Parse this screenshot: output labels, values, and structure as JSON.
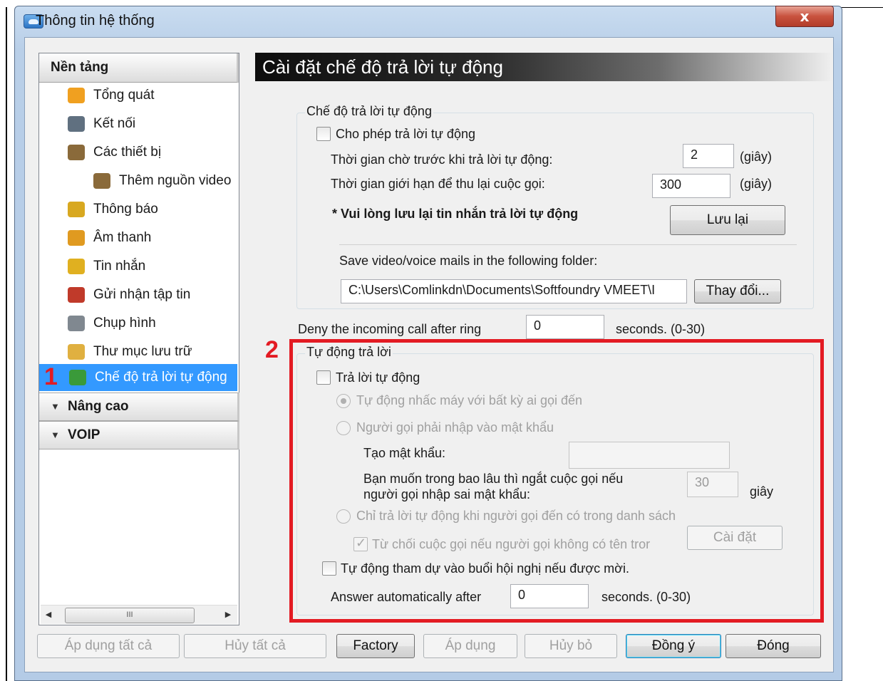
{
  "window": {
    "title": "Thông tin hệ thống",
    "close_label": "x"
  },
  "sidebar": {
    "header": "Nền tảng",
    "items": [
      {
        "label": "Tổng quát",
        "icon": "gear-icon",
        "color": "#f0a020"
      },
      {
        "label": "Kết nối",
        "icon": "network-icon",
        "color": "#607080"
      },
      {
        "label": "Các thiết bị",
        "icon": "devices-icon",
        "color": "#8a6a3a"
      },
      {
        "label": "Thêm nguồn video",
        "icon": "video-source-icon",
        "color": "#8a6a3a"
      },
      {
        "label": "Thông báo",
        "icon": "notification-icon",
        "color": "#d8a820"
      },
      {
        "label": "Âm thanh",
        "icon": "music-note-icon",
        "color": "#e09a20"
      },
      {
        "label": "Tin nhắn",
        "icon": "message-icon",
        "color": "#e0b020"
      },
      {
        "label": "Gửi nhận tập tin",
        "icon": "file-transfer-icon",
        "color": "#c03a2a"
      },
      {
        "label": "Chụp hình",
        "icon": "camera-icon",
        "color": "#808890"
      },
      {
        "label": "Thư mục lưu trữ",
        "icon": "folder-icon",
        "color": "#e0b040"
      },
      {
        "label": "Chế độ trả lời tự động",
        "icon": "auto-answer-icon",
        "color": "#3a9a3a"
      }
    ],
    "sections": [
      {
        "label": "Nâng cao"
      },
      {
        "label": "VOIP"
      }
    ],
    "scroll_thumb": "III"
  },
  "main": {
    "header": "Cài đặt chế độ trả lời tự động",
    "group1": {
      "title": "Chế độ trả lời tự động",
      "allow_label": "Cho phép trả lời tự động",
      "wait_label": "Thời gian chờ trước khi trả lời tự động:",
      "wait_value": "2",
      "wait_unit": "(giây)",
      "limit_label": "Thời gian giới hạn để thu lại cuộc gọi:",
      "limit_value": "300",
      "limit_unit": "(giây)",
      "save_note": "* Vui lòng lưu lại tin nhắn trả lời tự động",
      "save_button": "Lưu lại",
      "folder_label": "Save video/voice mails in the following folder:",
      "folder_value": "C:\\Users\\Comlinkdn\\Documents\\Softfoundry VMEET\\I",
      "change_button": "Thay đổi..."
    },
    "deny": {
      "label": "Deny the incoming call after ring",
      "value": "0",
      "unit": "seconds. (0-30)"
    },
    "group2": {
      "title": "Tự động trả lời",
      "auto_answer_label": "Trả lời tự động",
      "radio_any": "Tự động nhấc máy với bất kỳ ai gọi đến",
      "radio_password": "Người gọi phải nhập vào mật khẩu",
      "create_password_label": "Tạo mật khẩu:",
      "create_password_value": "",
      "timeout_label_1": "Bạn muốn trong bao lâu thì ngắt cuộc gọi nếu",
      "timeout_label_2": "người gọi nhập sai mật khẩu:",
      "timeout_value": "30",
      "timeout_unit": "giây",
      "radio_list": "Chỉ trả lời tự động khi người gọi đến có trong danh sách",
      "reject_label": "Từ chối cuộc gọi nếu người gọi không có tên tror",
      "setup_button": "Cài đặt",
      "conference_label": "Tự động tham dự vào buổi hội nghị nếu được mời.",
      "answer_after_label": "Answer automatically after",
      "answer_after_value": "0",
      "answer_after_unit": "seconds. (0-30)"
    }
  },
  "footer": {
    "apply_all": "Áp dụng tất cả",
    "cancel_all": "Hủy tất cả",
    "factory": "Factory",
    "apply": "Áp dụng",
    "cancel": "Hủy bỏ",
    "ok": "Đồng ý",
    "close": "Đóng"
  },
  "annotations": {
    "one": "1",
    "two": "2",
    "highlight_color": "#e31b23"
  }
}
